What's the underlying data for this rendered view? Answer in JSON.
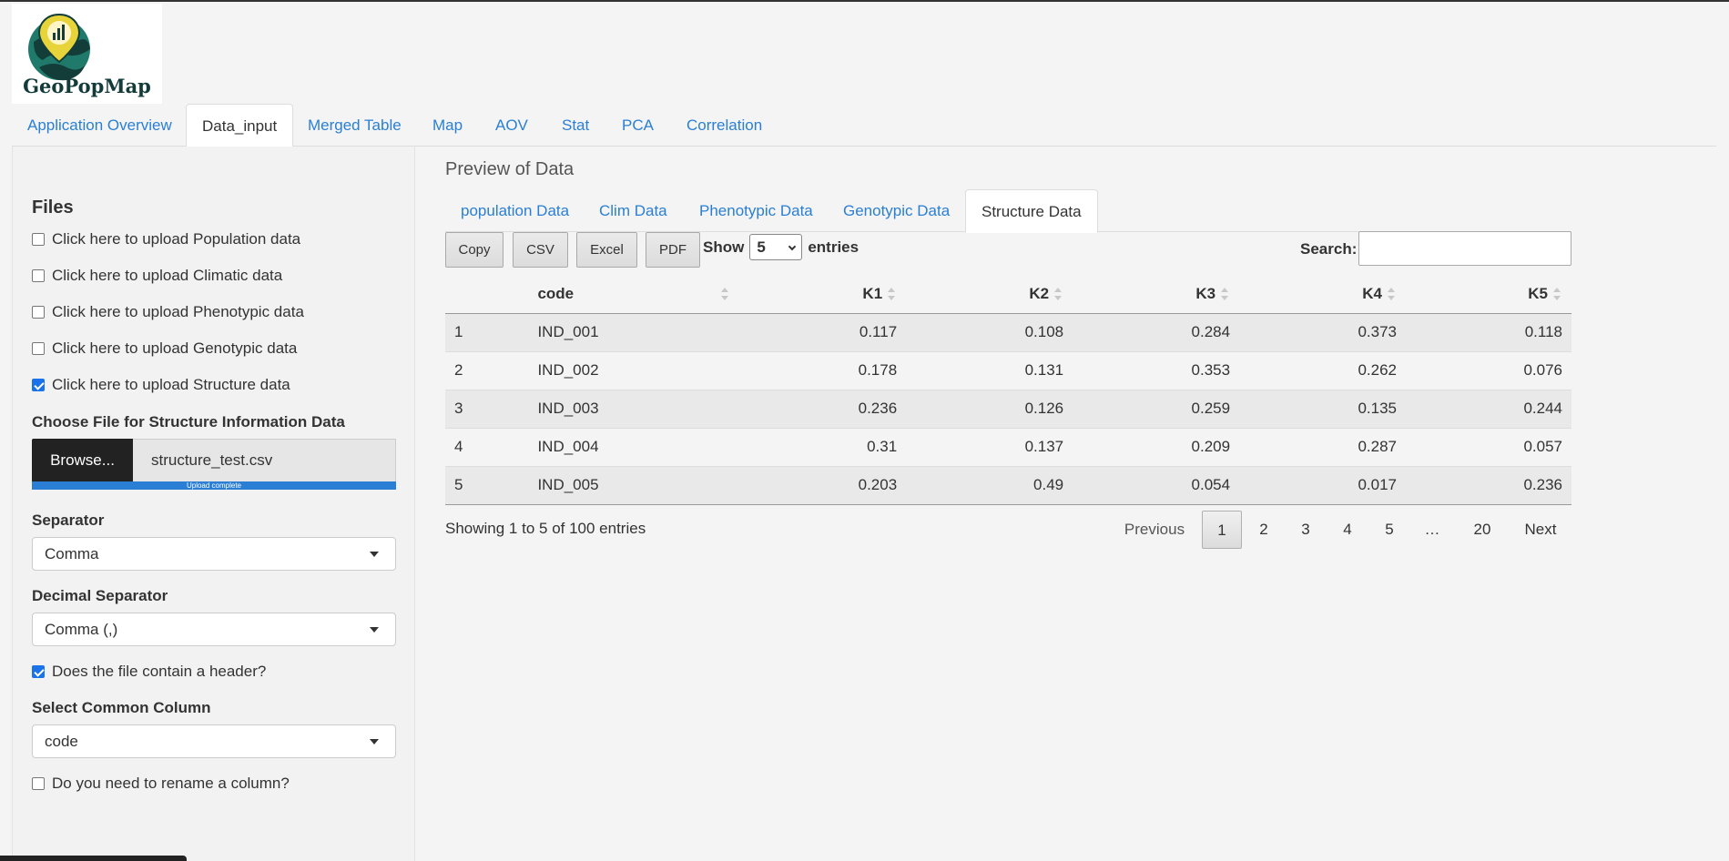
{
  "app": {
    "logo_text": "GeoPopMap"
  },
  "main_tabs": [
    {
      "label": "Application Overview"
    },
    {
      "label": "Data_input"
    },
    {
      "label": "Merged Table"
    },
    {
      "label": "Map"
    },
    {
      "label": "AOV"
    },
    {
      "label": "Stat"
    },
    {
      "label": "PCA"
    },
    {
      "label": "Correlation"
    }
  ],
  "sidebar": {
    "heading": "Files",
    "uploads": [
      {
        "label": "Click here to upload Population data",
        "checked": false
      },
      {
        "label": "Click here to upload Climatic data",
        "checked": false
      },
      {
        "label": "Click here to upload Phenotypic data",
        "checked": false
      },
      {
        "label": "Click here to upload Genotypic data",
        "checked": false
      },
      {
        "label": "Click here to upload Structure data",
        "checked": true
      }
    ],
    "file_label": "Choose File for Structure Information Data",
    "browse_label": "Browse...",
    "file_name": "structure_test.csv",
    "upload_status": "Upload complete",
    "separator_label": "Separator",
    "separator_value": "Comma",
    "decimal_label": "Decimal Separator",
    "decimal_value": "Comma (,)",
    "header_label": "Does the file contain a header?",
    "header_checked": true,
    "common_col_label": "Select Common Column",
    "common_col_value": "code",
    "rename_label": "Do you need to rename a column?",
    "rename_checked": false
  },
  "preview": {
    "title": "Preview of Data",
    "tabs": [
      {
        "label": "population Data"
      },
      {
        "label": "Clim Data"
      },
      {
        "label": "Phenotypic Data"
      },
      {
        "label": "Genotypic Data"
      },
      {
        "label": "Structure Data"
      }
    ],
    "buttons": {
      "copy": "Copy",
      "csv": "CSV",
      "excel": "Excel",
      "pdf": "PDF"
    },
    "show_label": "Show",
    "length_value": "5",
    "entries_label": "entries",
    "search_label": "Search:",
    "search_value": "",
    "columns": [
      "",
      "code",
      "K1",
      "K2",
      "K3",
      "K4",
      "K5"
    ],
    "rows": [
      [
        "1",
        "IND_001",
        "0.117",
        "0.108",
        "0.284",
        "0.373",
        "0.118"
      ],
      [
        "2",
        "IND_002",
        "0.178",
        "0.131",
        "0.353",
        "0.262",
        "0.076"
      ],
      [
        "3",
        "IND_003",
        "0.236",
        "0.126",
        "0.259",
        "0.135",
        "0.244"
      ],
      [
        "4",
        "IND_004",
        "0.31",
        "0.137",
        "0.209",
        "0.287",
        "0.057"
      ],
      [
        "5",
        "IND_005",
        "0.203",
        "0.49",
        "0.054",
        "0.017",
        "0.236"
      ]
    ],
    "info": "Showing 1 to 5 of 100 entries",
    "pagination": {
      "previous": "Previous",
      "pages": [
        "1",
        "2",
        "3",
        "4",
        "5",
        "…",
        "20"
      ],
      "current": "1",
      "next": "Next"
    }
  }
}
